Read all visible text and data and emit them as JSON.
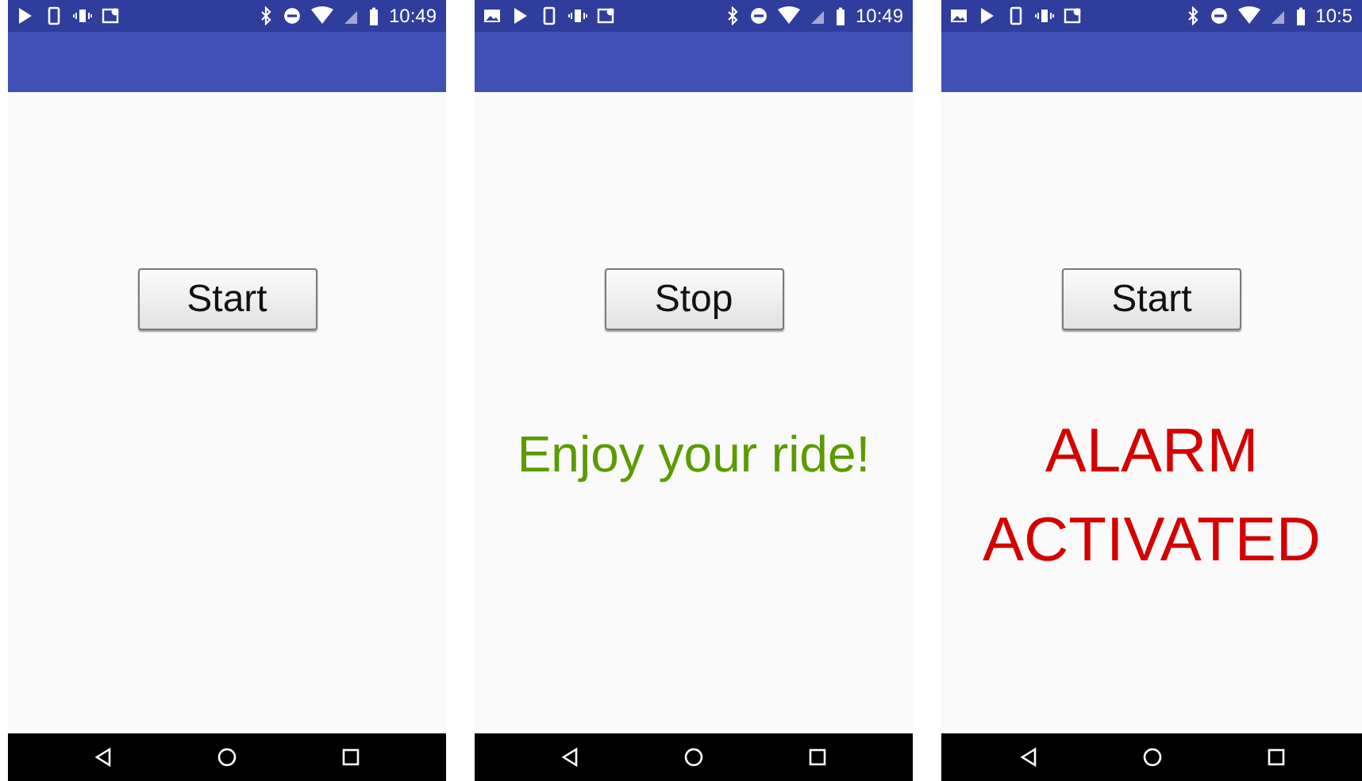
{
  "phones": [
    {
      "notification_icons": [
        {
          "kind": "play"
        },
        {
          "kind": "device"
        },
        {
          "kind": "vibrate"
        },
        {
          "kind": "photo-pin"
        }
      ],
      "time": "10:49",
      "button": "Start"
    },
    {
      "notification_icons": [
        {
          "kind": "image"
        },
        {
          "kind": "play"
        },
        {
          "kind": "device"
        },
        {
          "kind": "vibrate"
        },
        {
          "kind": "photo-pin"
        }
      ],
      "time": "10:49",
      "button": "Stop",
      "message": {
        "text": "Enjoy your ride!",
        "color": "#5c9a00",
        "kind": "normal"
      }
    },
    {
      "notification_icons": [
        {
          "kind": "image"
        },
        {
          "kind": "play"
        },
        {
          "kind": "device"
        },
        {
          "kind": "vibrate"
        },
        {
          "kind": "photo-pin"
        }
      ],
      "time": "10:5",
      "button": "Start",
      "message": {
        "text": "ALARM ACTIVATED",
        "color": "#d40000",
        "kind": "large"
      }
    }
  ]
}
